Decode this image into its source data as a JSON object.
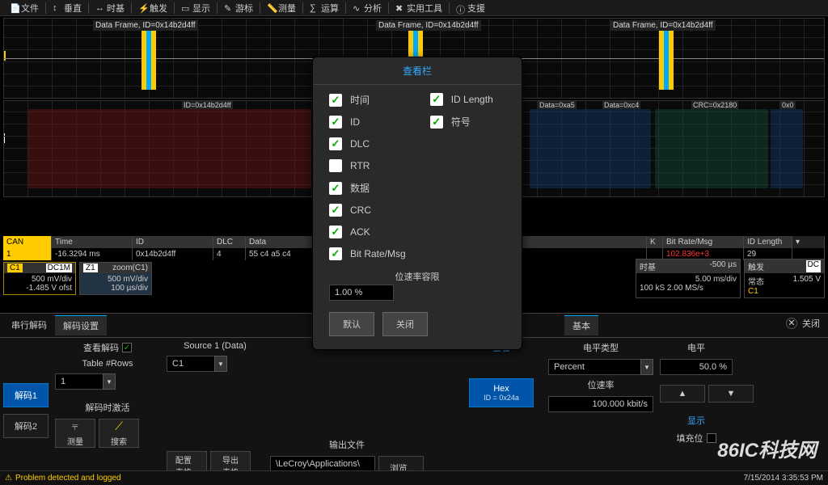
{
  "menu": [
    "文件",
    "垂直",
    "时基",
    "触发",
    "显示",
    "游标",
    "测量",
    "运算",
    "分析",
    "实用工具",
    "支援"
  ],
  "frames": {
    "label": "Data Frame",
    "id": "ID=0x14b2d4ff"
  },
  "seg_labels": {
    "id": "ID=0x14b2d4ff",
    "d1": "Data=0xa5",
    "d2": "Data=0xc4",
    "crc": "CRC=0x2180",
    "x0": "0x0"
  },
  "channels": {
    "c1": "C1",
    "z1": "Z1"
  },
  "table": {
    "hdrs": {
      "can": "CAN",
      "time": "Time",
      "id": "ID",
      "dlc": "DLC",
      "data": "Data",
      "k": "K",
      "bit": "Bit Rate/Msg",
      "idl": "ID Length"
    },
    "row": {
      "idx": "1",
      "time": "-16.3294 ms",
      "id": "0x14b2d4ff",
      "dlc": "4",
      "data": "55 c4 a5 c4",
      "bit": "102.836e+3",
      "idl": "29"
    }
  },
  "readouts": {
    "c1": {
      "tag": "C1",
      "badge": "DC1M",
      "l1": "500 mV/div",
      "l2": "-1.485 V ofst"
    },
    "z1": {
      "tag": "Z1",
      "sub": "zoom(C1)",
      "l1": "500 mV/div",
      "l2": "100 µs/div"
    },
    "tb": {
      "tag": "时基",
      "val": "-500 µs",
      "l1": "5.00 ms/div",
      "l2": "100 kS   2.00 MS/s"
    },
    "tr": {
      "tag": "触发",
      "badge": "DC",
      "l1": "常态",
      "l2": "1.505 V",
      "ch": "C1"
    }
  },
  "tabs": {
    "t1": "串行解码",
    "t2": "解码设置",
    "t3": "基本",
    "close": "关闭"
  },
  "lower": {
    "d1": "解码1",
    "d2": "解码2",
    "view_decode": "查看解码",
    "table_rows": "Table #Rows",
    "rows_val": "1",
    "activate": "解码时激活",
    "source": "Source 1 (Data)",
    "source_val": "C1",
    "measure": "测量",
    "search": "搜索",
    "config": "配置\n表格...",
    "export": "导出\n表格",
    "outfile": "输出文件",
    "outpath": "\\LeCroy\\Applications\\",
    "browse": "浏览..",
    "view": "查看",
    "hex": "Hex",
    "hex_sub": "ID = 0x24a",
    "level_type": "电平类型",
    "percent": "Percent",
    "level": "电平",
    "level_val": "50.0 %",
    "bitrate": "位速率",
    "bitrate_val": "100.000 kbit/s",
    "display": "显示",
    "fill": "填充位"
  },
  "modal": {
    "title": "查看栏",
    "left": [
      {
        "label": "时间",
        "on": true
      },
      {
        "label": "ID",
        "on": true
      },
      {
        "label": "DLC",
        "on": true
      },
      {
        "label": "RTR",
        "on": false
      },
      {
        "label": "数据",
        "on": true
      },
      {
        "label": "CRC",
        "on": true
      },
      {
        "label": "ACK",
        "on": true
      },
      {
        "label": "Bit Rate/Msg",
        "on": true
      }
    ],
    "right": [
      {
        "label": "ID Length",
        "on": true
      },
      {
        "label": "符号",
        "on": true
      }
    ],
    "tolerance_label": "位速率容限",
    "tolerance": "1.00 %",
    "default": "默认",
    "close": "关闭"
  },
  "status": {
    "msg": "Problem detected and logged",
    "time": "7/15/2014 3:35:53 PM"
  },
  "watermark": "86IC科技网"
}
